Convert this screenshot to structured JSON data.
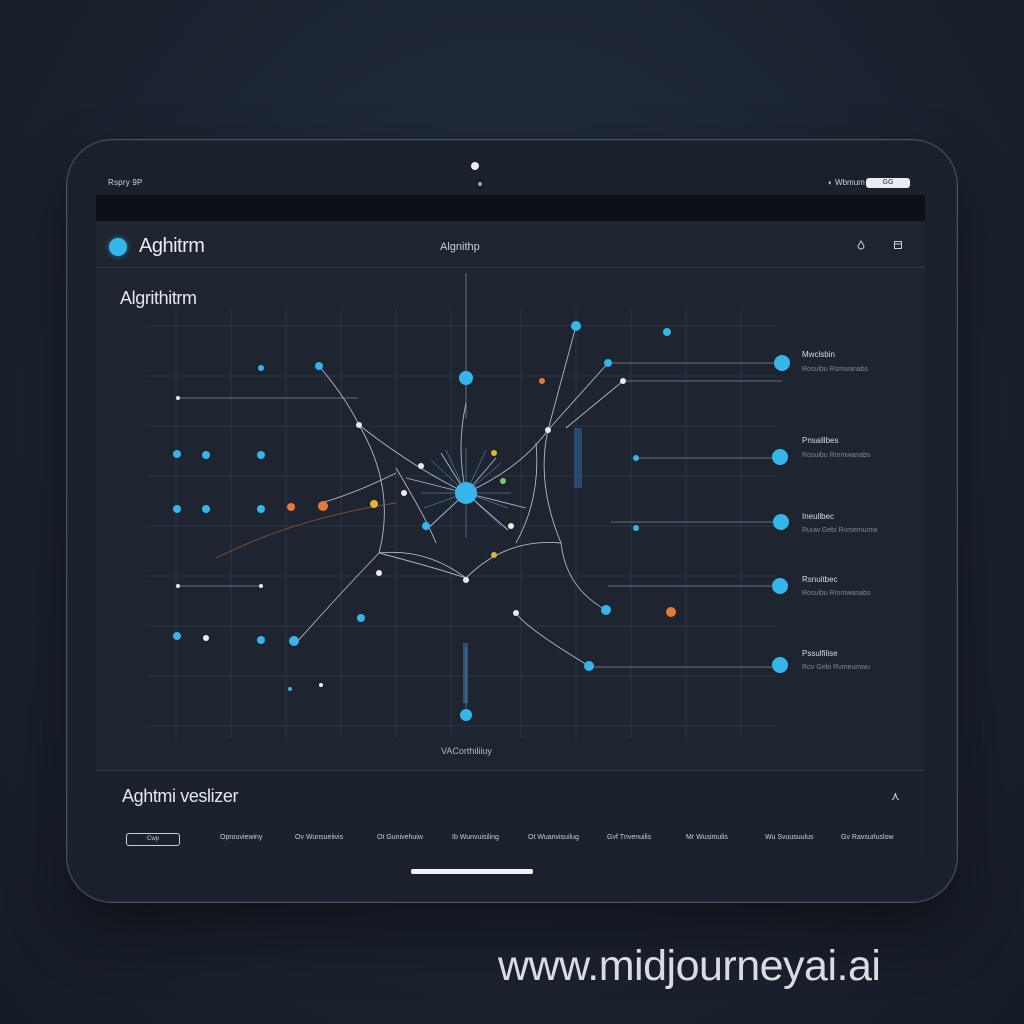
{
  "status_bar": {
    "left": "Rspry 9P",
    "right": "◐ Wbmum",
    "pill": "GG"
  },
  "header": {
    "app_title": "Aghitrm",
    "center_title": "Algnithp"
  },
  "viz": {
    "title": "Algrithitrm",
    "caption": "VACorthiliiuy"
  },
  "legend": [
    {
      "label": "Mwclsbin",
      "sub": "Rosuibu Rsmwanabs"
    },
    {
      "label": "Pnsaillbes",
      "sub": "Rosuibu Rmmwanabs"
    },
    {
      "label": "Ineullbec",
      "sub": "Ruuw Gebi Rvmemumw"
    },
    {
      "label": "Rsnuitbec",
      "sub": "Rosuibu Rmmwanabs"
    },
    {
      "label": "Pssulfilise",
      "sub": "Rov Gebi Rvmeumwu"
    }
  ],
  "bottom": {
    "title": "Aghtmi veslizer",
    "chevron": "⋏",
    "active_tab": "Cwp",
    "tabs": [
      "Oprouviewiny",
      "Ov Wunsueiivis",
      "Ot Gunivehuiw",
      "Ib Wunvuisiling",
      "Ot Wuanvisuilug",
      "Gvf Tnvenuilis",
      "Mr Wusimulis",
      "Wu Svuusuulus",
      "Gv Ravsurluslow"
    ]
  },
  "watermark": "www.midjourneyai.ai",
  "colors": {
    "accent_blue": "#35b6ea",
    "accent_orange": "#e57a38",
    "accent_yellow": "#e0b638",
    "background": "#1e2530"
  },
  "icons": {
    "header_left": "drop-icon",
    "header_right": "square-icon"
  }
}
